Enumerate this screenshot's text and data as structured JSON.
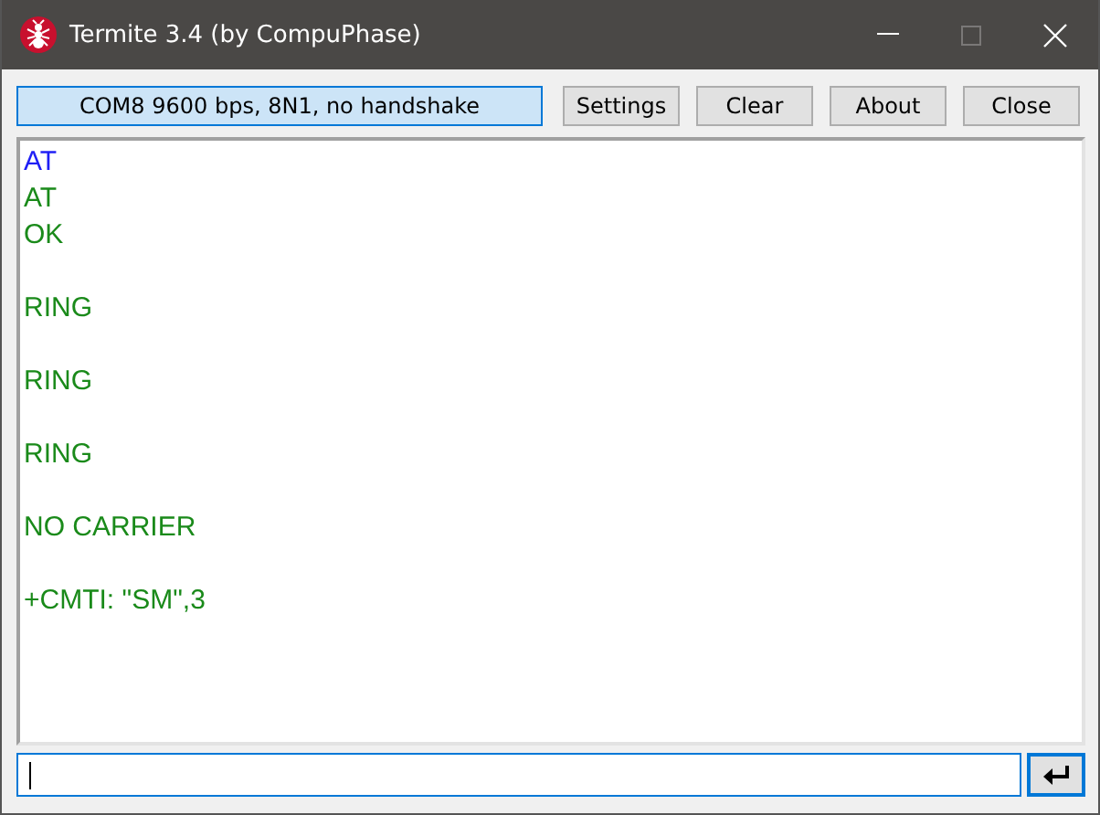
{
  "window": {
    "title": "Termite 3.4 (by CompuPhase)"
  },
  "toolbar": {
    "status": "COM8 9600 bps, 8N1, no handshake",
    "buttons": [
      "Settings",
      "Clear",
      "About",
      "Close"
    ]
  },
  "terminal": {
    "lines": [
      {
        "kind": "sent",
        "text": "AT"
      },
      {
        "kind": "received",
        "text": "AT"
      },
      {
        "kind": "received",
        "text": "OK"
      },
      {
        "kind": "blank"
      },
      {
        "kind": "received",
        "text": "RING"
      },
      {
        "kind": "blank"
      },
      {
        "kind": "received",
        "text": "RING"
      },
      {
        "kind": "blank"
      },
      {
        "kind": "received",
        "text": "RING"
      },
      {
        "kind": "blank"
      },
      {
        "kind": "received",
        "text": "NO CARRIER"
      },
      {
        "kind": "blank"
      },
      {
        "kind": "received",
        "text": "+CMTI: \"SM\",3"
      }
    ]
  }
}
